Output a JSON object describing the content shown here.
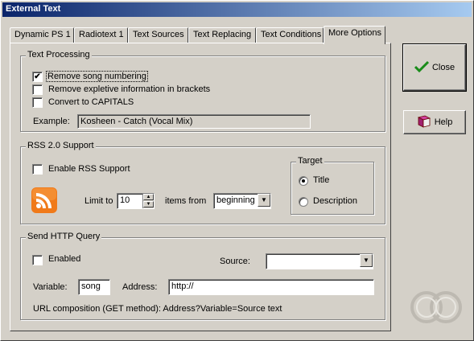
{
  "window": {
    "title": "External Text"
  },
  "tabs": [
    {
      "label": "Dynamic PS 1"
    },
    {
      "label": "Radiotext 1"
    },
    {
      "label": "Text Sources"
    },
    {
      "label": "Text Replacing"
    },
    {
      "label": "Text Conditions"
    },
    {
      "label": "More Options",
      "active": true
    }
  ],
  "text_processing": {
    "title": "Text Processing",
    "remove_song_numbering": {
      "label": "Remove song numbering",
      "checked": true
    },
    "remove_expletive": {
      "label": "Remove expletive information in brackets",
      "checked": false
    },
    "convert_capitals": {
      "label": "Convert to CAPITALS",
      "checked": false
    },
    "example_label": "Example:",
    "example_value": "Kosheen - Catch (Vocal Mix)"
  },
  "rss": {
    "title": "RSS 2.0 Support",
    "enable": {
      "label": "Enable RSS Support",
      "checked": false
    },
    "limit_label": "Limit to",
    "limit_value": "10",
    "items_from_label": "items from",
    "items_from_value": "beginning",
    "target": {
      "title": "Target",
      "options": [
        {
          "label": "Title",
          "selected": true
        },
        {
          "label": "Description",
          "selected": false
        }
      ]
    }
  },
  "http_query": {
    "title": "Send HTTP Query",
    "enabled": {
      "label": "Enabled",
      "checked": false
    },
    "source_label": "Source:",
    "source_value": "",
    "variable_label": "Variable:",
    "variable_value": "song",
    "address_label": "Address:",
    "address_value": "http://",
    "url_composition": "URL composition (GET method): Address?Variable=Source text"
  },
  "buttons": {
    "close": "Close",
    "help": "Help"
  },
  "colors": {
    "face": "#d4d0c8",
    "title_start": "#0a246a",
    "title_end": "#a6caf0",
    "rss_orange": "#f07a1a",
    "check_green": "#1a8c1a"
  }
}
